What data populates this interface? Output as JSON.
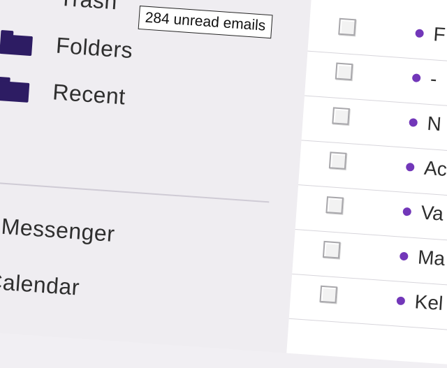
{
  "sidebar": {
    "items": [
      {
        "label": "Trash"
      },
      {
        "label": "Folders"
      },
      {
        "label": "Recent"
      },
      {
        "label": "Messenger"
      },
      {
        "label": "Calendar"
      }
    ]
  },
  "tooltip": {
    "text": "284 unread emails"
  },
  "email_list": {
    "rows": [
      {
        "sender": "F"
      },
      {
        "sender": "-"
      },
      {
        "sender": "N"
      },
      {
        "sender": "Ac"
      },
      {
        "sender": "Va"
      },
      {
        "sender": "Ma"
      },
      {
        "sender": "Kel"
      }
    ]
  },
  "colors": {
    "unread_dot": "#7237b9",
    "folder_icon": "#2d1c63"
  }
}
